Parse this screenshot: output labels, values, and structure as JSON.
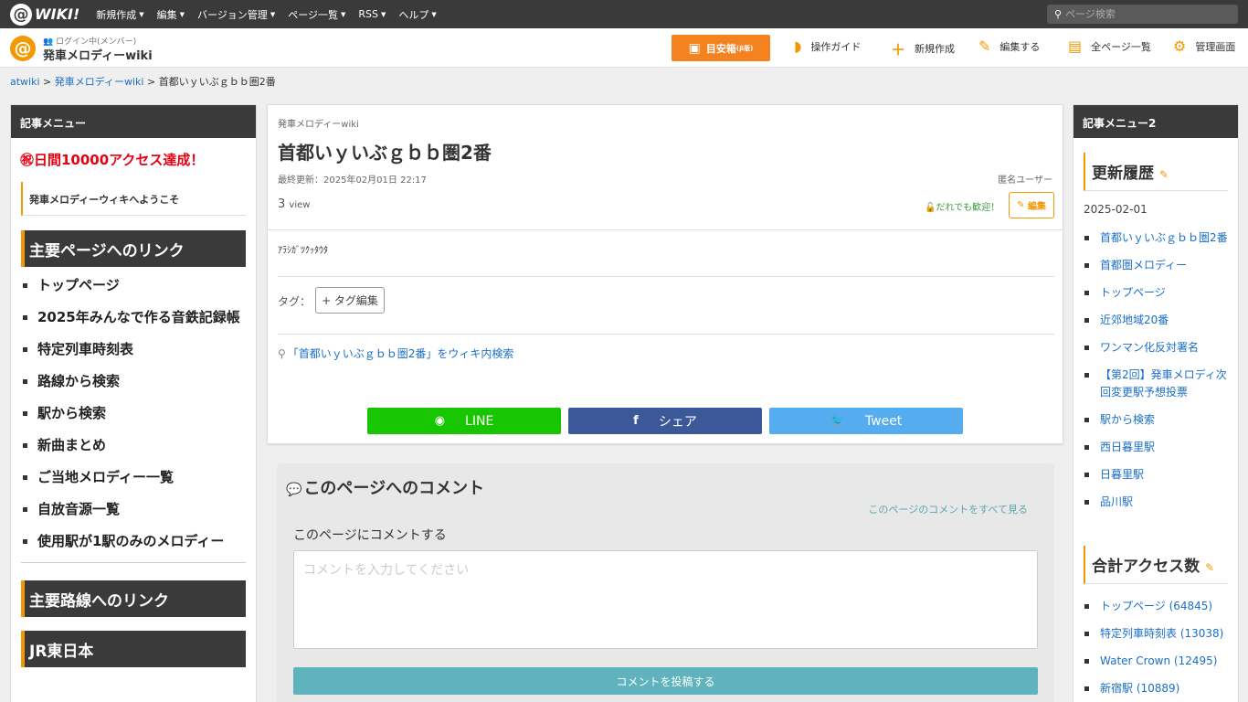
{
  "topbar": {
    "logo_mark": "@",
    "logo_text": "WIKI!",
    "nav": [
      "新規作成",
      "編集",
      "バージョン管理",
      "ページ一覧",
      "RSS",
      "ヘルプ"
    ],
    "search_placeholder": "ページ検索"
  },
  "header": {
    "site_logo_mark": "@",
    "login_status": "ログイン中(メンバー)",
    "site_name": "発車メロディーwiki",
    "book_button": "目安箱",
    "book_badge": "(β版)",
    "links": [
      "操作ガイド",
      "新規作成",
      "編集する",
      "全ページ一覧",
      "管理画面"
    ]
  },
  "breadcrumb": {
    "items": [
      "atwiki",
      "発車メロディーwiki",
      "首都いｙいぶｇｂｂ圏2番"
    ],
    "separator": ">"
  },
  "left_sidebar": {
    "header": "記事メニュー",
    "celebrate": "㊗日間10000アクセス達成！",
    "welcome": "発車メロディーウィキへようこそ",
    "section1": "主要ページへのリンク",
    "links": [
      "トップページ",
      "2025年みんなで作る音鉄記録帳",
      "特定列車時刻表",
      "路線から検索",
      "駅から検索",
      "新曲まとめ",
      "ご当地メロディー一覧",
      "自放音源一覧",
      "使用駅が1駅のみのメロディー"
    ],
    "section2": "主要路線へのリンク",
    "section3": "JR東日本"
  },
  "content": {
    "wiki_label": "発車メロディーwiki",
    "title": "首都いｙいぶｇｂｂ圏2番",
    "updated": "最終更新：2025年02月01日 22:17",
    "author": "匿名ユーザー",
    "views_count": "3",
    "views_unit": "view",
    "welcome_note": "だれでも歓迎！",
    "edit_button": "編集",
    "body_text": "ｱﾗｼｶﾞﾂｸｯﾀｳﾀ",
    "tag_label": "タグ：",
    "tag_button": "+ タグ編集",
    "search_link": "「首都いｙいぶｇｂｂ圏2番」をウィキ内検索",
    "share": {
      "line": "LINE",
      "facebook": "シェア",
      "twitter": "Tweet"
    }
  },
  "comments": {
    "title": "このページへのコメント",
    "see_all": "このページのコメントをすべて見る",
    "label": "このページにコメントする",
    "placeholder": "コメントを入力してください",
    "post_button": "コメントを投稿する"
  },
  "right_sidebar": {
    "header": "記事メニュー2",
    "history_title": "更新履歴",
    "date": "2025-02-01",
    "history": [
      "首都いｙいぶｇｂｂ圏2番",
      "首都圏メロディー",
      "トップページ",
      "近郊地域20番",
      "ワンマン化反対署名",
      "【第2回】発車メロディ次回変更駅予想投票",
      "駅から検索",
      "西日暮里駅",
      "日暮里駅",
      "品川駅"
    ],
    "access_title": "合計アクセス数",
    "access": [
      "トップページ (64845)",
      "特定列車時刻表 (13038)",
      "Water Crown (12495)",
      "新宿駅 (10889)"
    ]
  },
  "colors": {
    "accent": "#f39800",
    "topbar": "#3a3a3a",
    "line": "#17c600",
    "facebook": "#3b5998",
    "twitter": "#55acee",
    "post": "#5fb3bd",
    "celebrate": "#e60012"
  }
}
